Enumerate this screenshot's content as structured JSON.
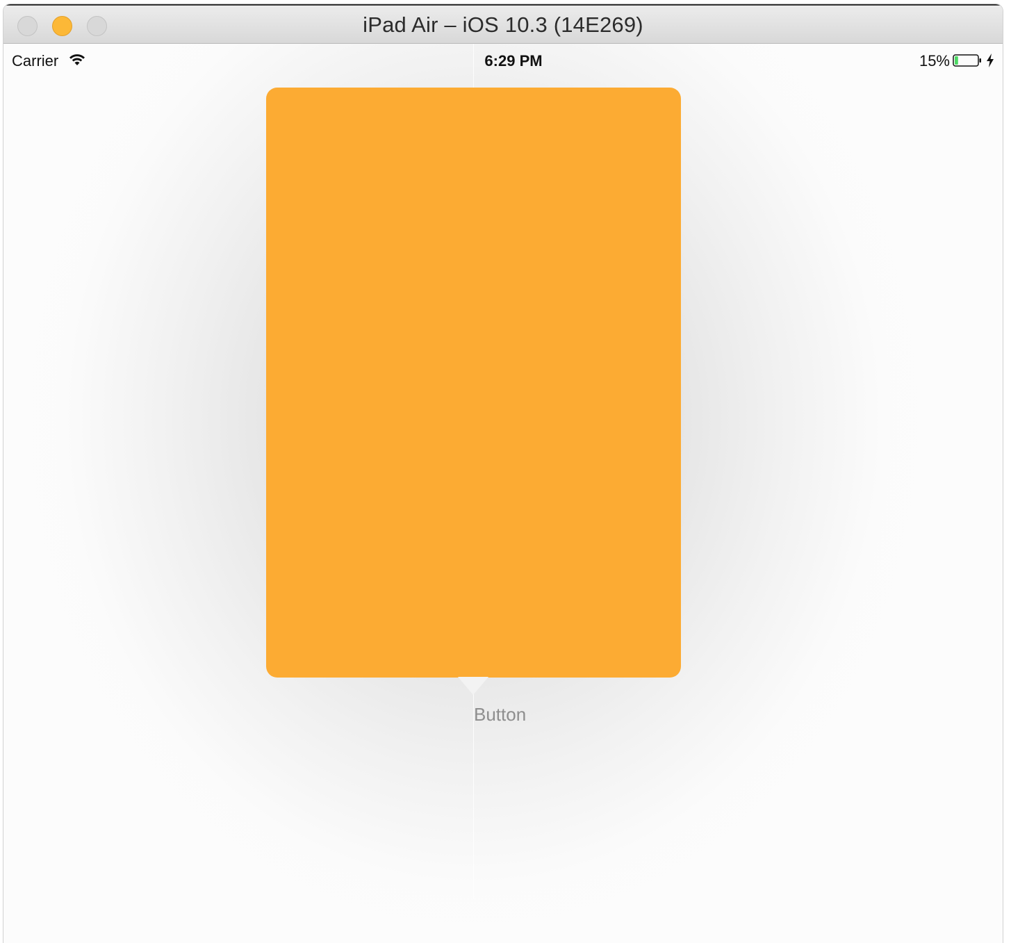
{
  "window": {
    "title": "iPad Air – iOS 10.3 (14E269)"
  },
  "status_bar": {
    "carrier": "Carrier",
    "time": "6:29 PM",
    "battery_percent": "15%",
    "battery_level": 0.15
  },
  "content": {
    "card_color": "#fcab33",
    "button_label": "Button"
  },
  "colors": {
    "accent": "#fcab33",
    "battery_fill": "#4cd964",
    "minimize_button": "#fcb837"
  },
  "icons": [
    "wifi-icon",
    "battery-icon",
    "charging-bolt-icon"
  ]
}
